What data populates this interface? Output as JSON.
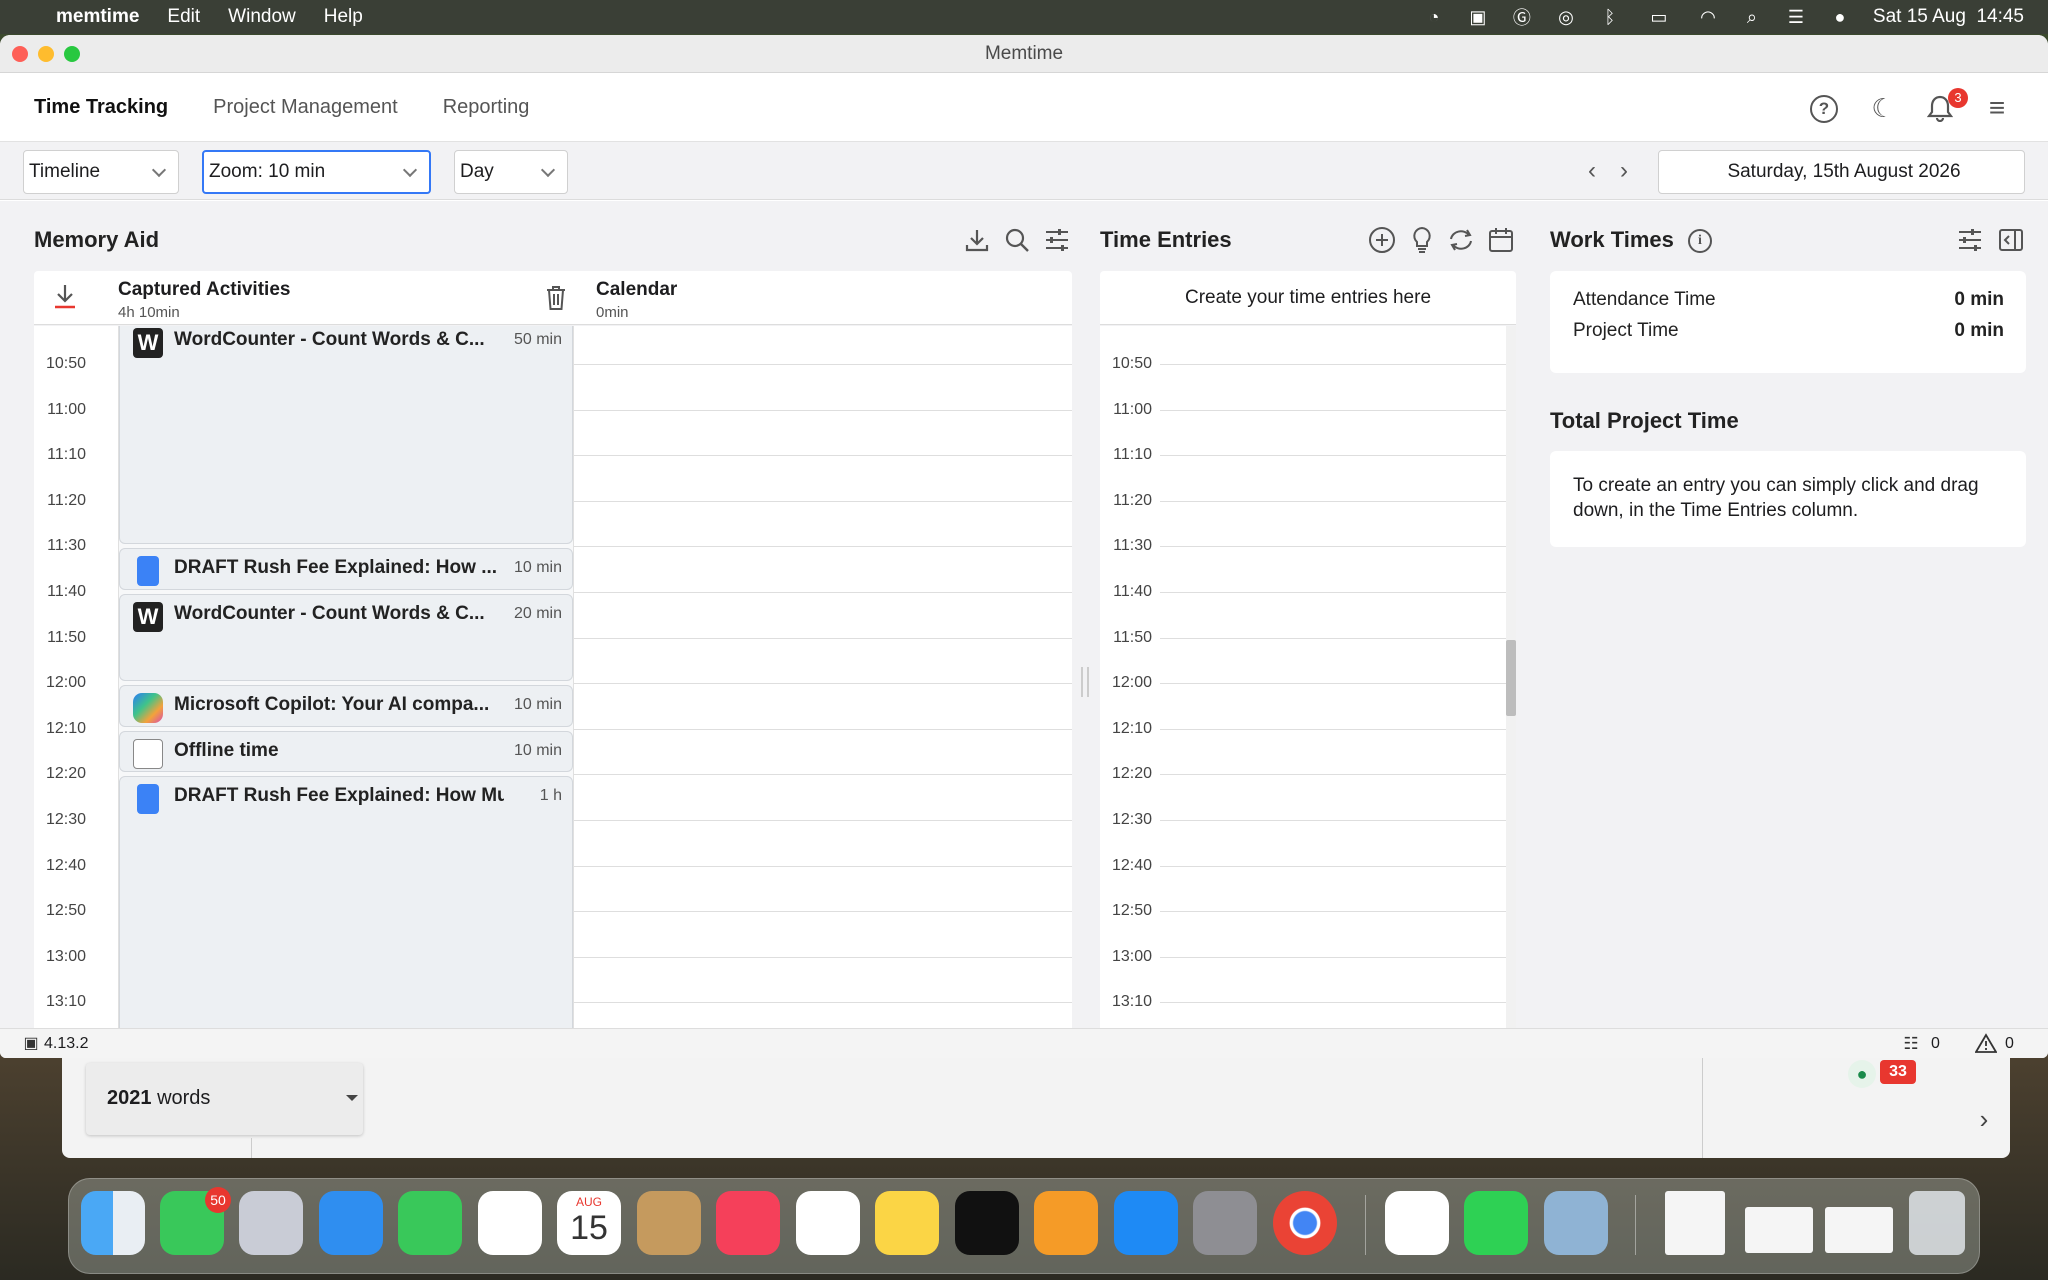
{
  "menubar": {
    "app_name": "memtime",
    "items": [
      "Edit",
      "Window",
      "Help"
    ],
    "datetime": "Sat 15 Aug  14:45"
  },
  "window": {
    "title": "Memtime"
  },
  "nav": {
    "tabs": [
      "Time Tracking",
      "Project Management",
      "Reporting"
    ],
    "notification_count": "3"
  },
  "toolbar": {
    "view": "Timeline",
    "zoom": "Zoom: 10 min",
    "range": "Day",
    "date": "Saturday, 15th August 2026"
  },
  "memory_aid": {
    "title": "Memory Aid",
    "captured": {
      "label": "Captured Activities",
      "total": "4h 10min"
    },
    "calendar": {
      "label": "Calendar",
      "total": "0min"
    },
    "times": [
      "10:50",
      "11:00",
      "11:10",
      "11:20",
      "11:30",
      "11:40",
      "11:50",
      "12:00",
      "12:10",
      "12:20",
      "12:30",
      "12:40",
      "12:50",
      "13:00",
      "13:10"
    ],
    "activities": [
      {
        "title": "WordCounter - Count Words & C...",
        "duration": "50 min",
        "icon": "w-icon"
      },
      {
        "title": "DRAFT Rush Fee Explained: How ...",
        "duration": "10 min",
        "icon": "google-docs-icon"
      },
      {
        "title": "WordCounter - Count Words & C...",
        "duration": "20 min",
        "icon": "w-icon"
      },
      {
        "title": "Microsoft Copilot: Your AI compa...",
        "duration": "10 min",
        "icon": "copilot-icon"
      },
      {
        "title": "Offline time",
        "duration": "10 min",
        "icon": "offline-icon"
      },
      {
        "title": "DRAFT Rush Fee Explained: How Mu...",
        "duration": "1 h",
        "icon": "google-docs-icon"
      }
    ]
  },
  "time_entries": {
    "title": "Time Entries",
    "create_hint": "Create your time entries here"
  },
  "work_times": {
    "title": "Work Times",
    "attendance_label": "Attendance Time",
    "attendance_value": "0 min",
    "project_label": "Project Time",
    "project_value": "0 min",
    "total_title": "Total Project Time",
    "total_hint": "To create an entry you can simply click and drag down, in the Time Entries column."
  },
  "status": {
    "version": "4.13.2",
    "tasks_count": "0",
    "warnings_count": "0"
  },
  "background_doc": {
    "word_count": "2021",
    "word_label": "words",
    "badge": "33"
  },
  "dock": {
    "messages_badge": "50",
    "calendar_month": "AUG",
    "calendar_day": "15"
  },
  "colors": {
    "accent": "#3478f6",
    "notification": "#e8372f"
  }
}
